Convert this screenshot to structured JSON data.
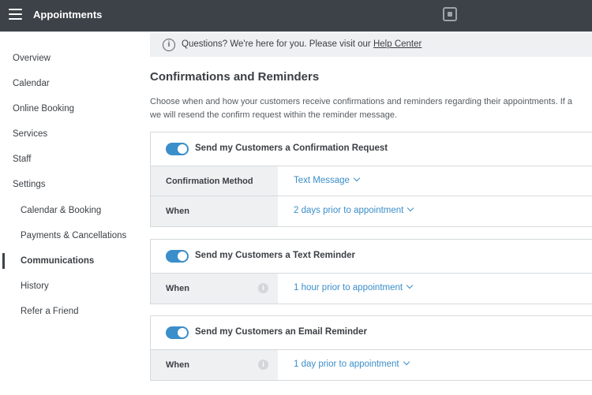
{
  "topbar": {
    "title": "Appointments"
  },
  "sidebar": {
    "items": [
      {
        "label": "Overview"
      },
      {
        "label": "Calendar"
      },
      {
        "label": "Online Booking"
      },
      {
        "label": "Services"
      },
      {
        "label": "Staff"
      },
      {
        "label": "Settings"
      },
      {
        "label": "Calendar & Booking"
      },
      {
        "label": "Payments & Cancellations"
      },
      {
        "label": "Communications"
      },
      {
        "label": "History"
      },
      {
        "label": "Refer a Friend"
      }
    ],
    "active": "Communications"
  },
  "banner": {
    "text": "Questions? We're here for you. Please visit our",
    "link": "Help Center"
  },
  "main": {
    "title": "Confirmations and Reminders",
    "desc_line1": "Choose when and how your customers receive confirmations and reminders regarding their appointments. If a",
    "desc_line2": "we will resend the confirm request within the reminder message."
  },
  "cards": [
    {
      "title": "Send my Customers a Confirmation Request",
      "enabled": true,
      "rows": [
        {
          "label": "Confirmation Method",
          "value": "Text Message"
        },
        {
          "label": "When",
          "value": "2 days prior to appointment"
        }
      ]
    },
    {
      "title": "Send my Customers a Text Reminder",
      "enabled": true,
      "rows": [
        {
          "label": "When",
          "value": "1 hour prior to appointment"
        }
      ]
    },
    {
      "title": "Send my Customers an Email Reminder",
      "enabled": true,
      "rows": [
        {
          "label": "When",
          "value": "1 day prior to appointment"
        }
      ]
    }
  ],
  "colors": {
    "topbar": "#3c4248",
    "accent": "#3a8ec9",
    "label_bg": "#eef0f2"
  }
}
